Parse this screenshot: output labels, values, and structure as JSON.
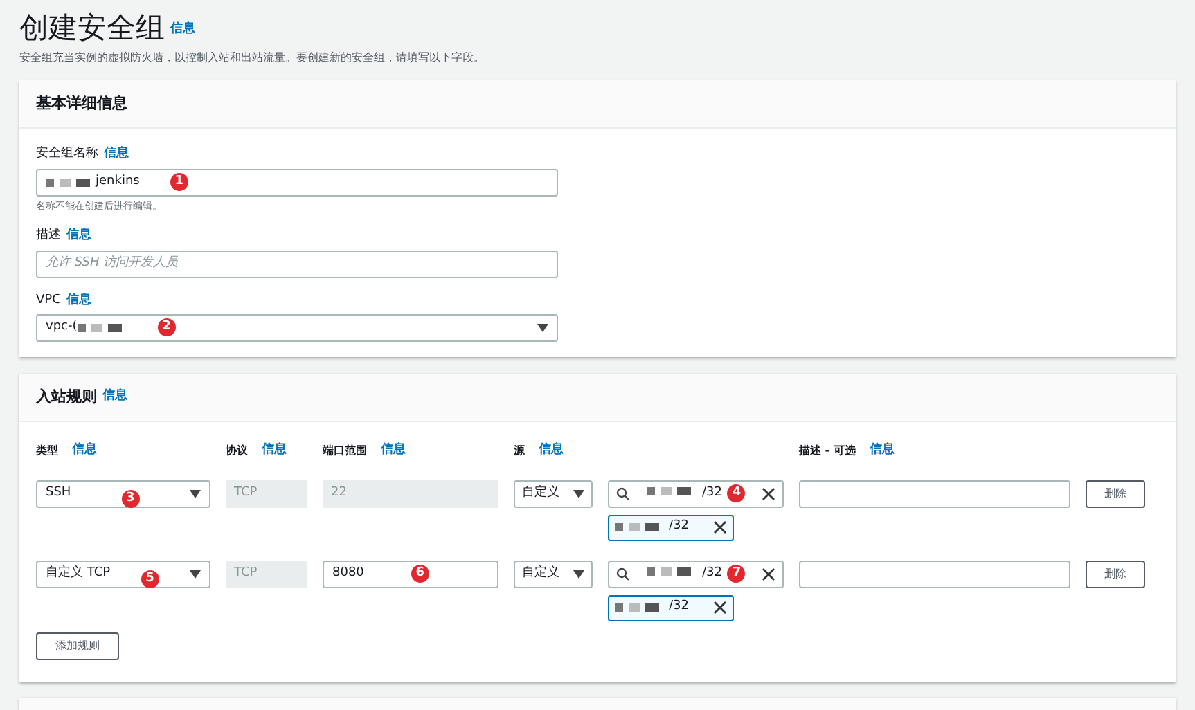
{
  "page": {
    "title": "创建安全组",
    "info": "信息",
    "description": "安全组充当实例的虚拟防火墙，以控制入站和出站流量。要创建新的安全组，请填写以下字段。"
  },
  "basic": {
    "heading": "基本详细信息",
    "fields": [
      {
        "kind": "text",
        "label": "安全组名称",
        "info": "信息",
        "value": "jenkins",
        "redacted": true,
        "marker": "1",
        "hint": "名称不能在创建后进行编辑。"
      },
      {
        "kind": "text",
        "label": "描述",
        "info": "信息",
        "placeholder": "允许 SSH 访问开发人员"
      },
      {
        "kind": "select",
        "label": "VPC",
        "info": "信息",
        "value": "vpc-(",
        "redacted": true,
        "marker": "2"
      }
    ]
  },
  "inbound": {
    "heading": "入站规则",
    "info": "信息",
    "columns": [
      {
        "label": "类型",
        "info": "信息"
      },
      {
        "label": "协议",
        "info": "信息"
      },
      {
        "label": "端口范围",
        "info": "信息"
      },
      {
        "label": "源",
        "info": "信息"
      },
      {
        "label": "描述 - 可选",
        "info": "信息"
      }
    ],
    "rows": [
      {
        "type": "SSH",
        "type_marker": "3",
        "protocol": "TCP",
        "port": "22",
        "port_disabled": true,
        "source": "自定义",
        "cidr": "/32",
        "cidr_marker": "4",
        "token": "/32",
        "delete": "删除"
      },
      {
        "type": "自定义 TCP",
        "type_marker": "5",
        "protocol": "TCP",
        "port": "8080",
        "port_disabled": false,
        "port_marker": "6",
        "source": "自定义",
        "cidr": "/32",
        "cidr_marker": "7",
        "token": "/32",
        "delete": "删除"
      }
    ],
    "add_button": "添加规则"
  }
}
